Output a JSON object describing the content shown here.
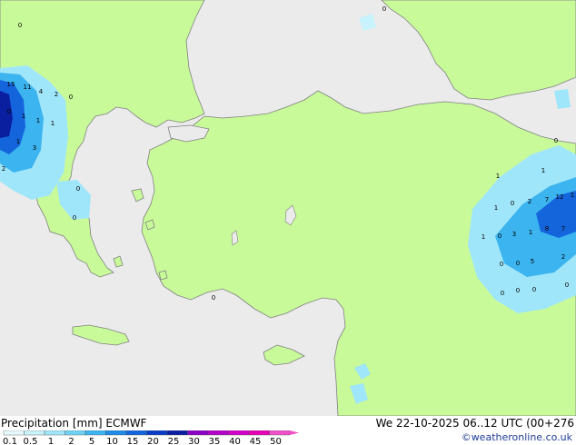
{
  "footer": {
    "title": "Precipitation [mm]  ECMWF",
    "datetime": "We 22-10-2025 06..12 UTC (00+276",
    "credit": "©weatheronline.co.uk"
  },
  "legend": {
    "ticks": [
      "0.1",
      "0.5",
      "1",
      "2",
      "5",
      "10",
      "15",
      "20",
      "25",
      "30",
      "35",
      "40",
      "45",
      "50"
    ],
    "colors": [
      "#e6fafe",
      "#c8f2fc",
      "#a0e6fa",
      "#6ed2f5",
      "#3cb4f0",
      "#1e8ce6",
      "#1464dc",
      "#0a3cc8",
      "#0a1ea0",
      "#8c00c8",
      "#b400c8",
      "#d200c8",
      "#e600b4",
      "#f050c8"
    ]
  },
  "colors": {
    "land": "#c8fa9a",
    "sea": "#ebebeb",
    "coast": "#808080"
  },
  "map_labels": [
    "0",
    "15",
    "11",
    "4",
    "2",
    "0",
    "0",
    "1",
    "1",
    "1",
    "1",
    "3",
    "2",
    "0",
    "0",
    "1",
    "0",
    "1",
    "12",
    "1",
    "1",
    "0",
    "2",
    "7",
    "3",
    "1",
    "8",
    "0",
    "1",
    "7",
    "0",
    "0",
    "5",
    "2",
    "0",
    "0",
    "0",
    "0",
    "0",
    "0"
  ]
}
